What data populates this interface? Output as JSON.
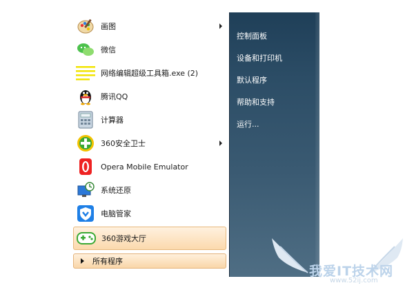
{
  "start_menu": {
    "programs": [
      {
        "label": "画图",
        "icon": "paint-icon",
        "has_submenu": true
      },
      {
        "label": "微信",
        "icon": "wechat-icon",
        "has_submenu": false
      },
      {
        "label": "网络编辑超级工具箱.exe (2)",
        "icon": "text-lines-icon",
        "has_submenu": false
      },
      {
        "label": "腾讯QQ",
        "icon": "qq-penguin-icon",
        "has_submenu": false
      },
      {
        "label": "计算器",
        "icon": "calculator-icon",
        "has_submenu": false
      },
      {
        "label": "360安全卫士",
        "icon": "360-security-icon",
        "has_submenu": true
      },
      {
        "label": "Opera Mobile Emulator",
        "icon": "opera-icon",
        "has_submenu": false
      },
      {
        "label": "系统还原",
        "icon": "system-restore-icon",
        "has_submenu": false
      },
      {
        "label": "电脑管家",
        "icon": "pc-manager-shield-icon",
        "has_submenu": false
      },
      {
        "label": "360游戏大厅",
        "icon": "gamepad-icon",
        "has_submenu": false,
        "highlighted": true
      }
    ],
    "all_programs": "所有程序",
    "right_items": [
      {
        "label": "控制面板"
      },
      {
        "label": "设备和打印机"
      },
      {
        "label": "默认程序"
      },
      {
        "label": "帮助和支持"
      },
      {
        "label": "运行..."
      }
    ]
  },
  "watermark": {
    "main": "我爱IT技术网",
    "sub": "www.52ij.com"
  },
  "colors": {
    "right_pane": "#2c4d66",
    "highlight": "#fbd9ad"
  }
}
